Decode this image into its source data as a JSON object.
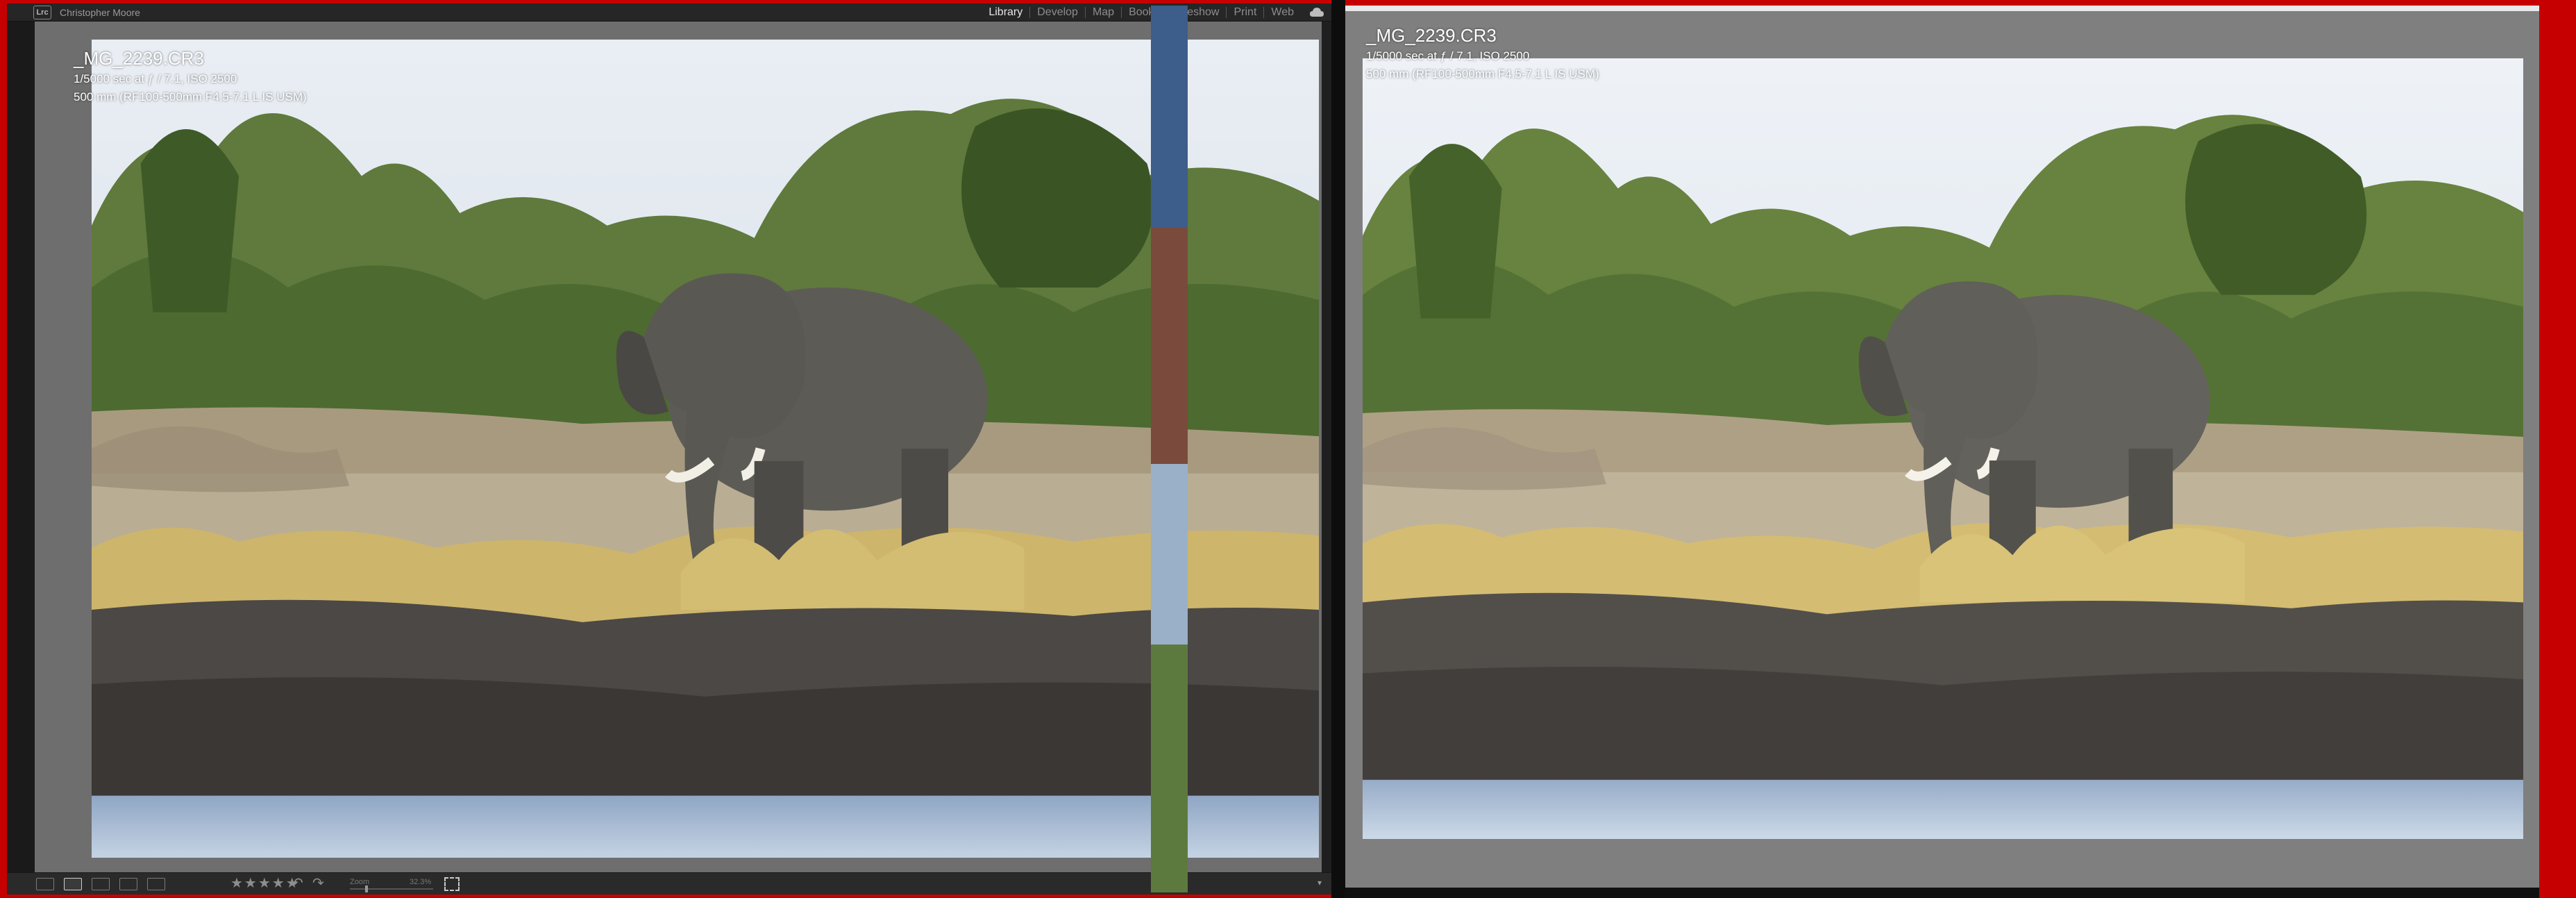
{
  "app": {
    "logo_text": "Lrc",
    "identity_plate": "Christopher Moore",
    "modules": [
      "Library",
      "Develop",
      "Map",
      "Book",
      "Slideshow",
      "Print",
      "Web"
    ],
    "active_module": "Library",
    "cloud_icon": "cloud-sync-icon"
  },
  "loupe_info": {
    "filename": "_MG_2239.CR3",
    "exposure": "1/5000 sec at ƒ / 7.1, ISO 2500",
    "lens": "500 mm (RF100-500mm F4.5-7.1 L IS USM)"
  },
  "toolbar": {
    "view_modes": [
      "grid-view-icon",
      "loupe-view-icon",
      "compare-view-icon",
      "survey-view-icon",
      "people-view-icon"
    ],
    "active_view": "loupe-view-icon",
    "rating": "★★★★★",
    "rotate_left": "↶",
    "rotate_right": "↷",
    "zoom_label": "Zoom",
    "zoom_value": "32.3%",
    "menu_glyph": "▾"
  },
  "compare_info": {
    "filename": "_MG_2239.CR3",
    "exposure": "1/5000 sec at ƒ / 7.1, ISO 2500",
    "lens": "500 mm (RF100-500mm F4.5-7.1 L IS USM)"
  },
  "colors": {
    "frame": "#c60000",
    "lr_background": "#6e6e6e",
    "compare_background": "#7f7f7f",
    "active_module": "#e6e6e6"
  }
}
